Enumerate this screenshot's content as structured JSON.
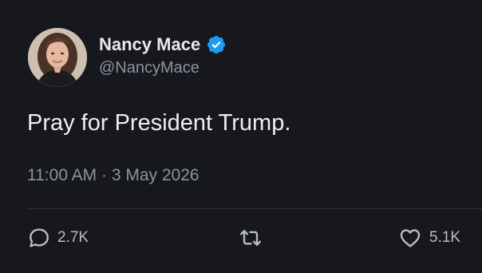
{
  "author": {
    "display_name": "Nancy Mace",
    "handle": "@NancyMace",
    "verified": true,
    "verified_color": "#1d9bf0"
  },
  "tweet": {
    "text": "Pray for President Trump.",
    "timestamp": "11:00 AM · 3 May 2026"
  },
  "actions": {
    "reply": {
      "icon": "reply-icon",
      "count": "2.7K"
    },
    "retweet": {
      "icon": "retweet-icon",
      "count": ""
    },
    "like": {
      "icon": "heart-icon",
      "count": "5.1K"
    }
  },
  "theme": {
    "background": "#16181d",
    "text_primary": "#e7e9ea",
    "text_secondary": "#8b949e",
    "divider": "#2f3336"
  }
}
